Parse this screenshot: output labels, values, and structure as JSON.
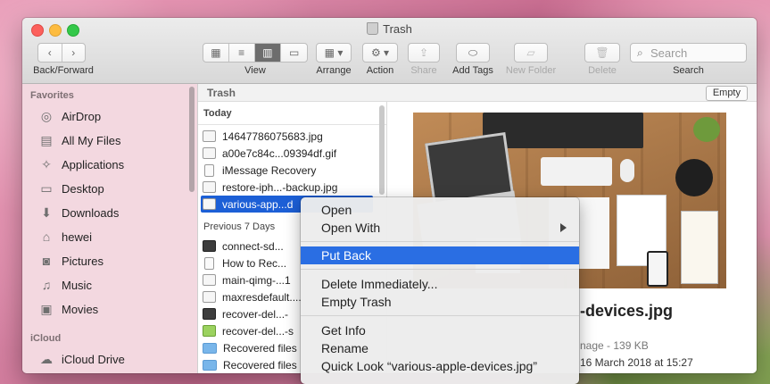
{
  "window": {
    "title": "Trash"
  },
  "toolbar": {
    "back_forward_label": "Back/Forward",
    "view_label": "View",
    "arrange_label": "Arrange",
    "action_label": "Action",
    "share_label": "Share",
    "add_tags_label": "Add Tags",
    "new_folder_label": "New Folder",
    "delete_label": "Delete",
    "search_label": "Search",
    "search_placeholder": "Search"
  },
  "sidebar": {
    "favorites_heading": "Favorites",
    "items": [
      {
        "label": "AirDrop",
        "icon": "airdrop-icon"
      },
      {
        "label": "All My Files",
        "icon": "all-files-icon"
      },
      {
        "label": "Applications",
        "icon": "applications-icon"
      },
      {
        "label": "Desktop",
        "icon": "desktop-icon"
      },
      {
        "label": "Downloads",
        "icon": "downloads-icon"
      },
      {
        "label": "hewei",
        "icon": "home-icon"
      },
      {
        "label": "Pictures",
        "icon": "camera-icon"
      },
      {
        "label": "Music",
        "icon": "music-icon"
      },
      {
        "label": "Movies",
        "icon": "movies-icon"
      }
    ],
    "icloud_heading": "iCloud",
    "icloud_items": [
      {
        "label": "iCloud Drive",
        "icon": "cloud-icon"
      }
    ]
  },
  "path_bar": {
    "title": "Trash",
    "empty_button": "Empty"
  },
  "files": {
    "today_heading": "Today",
    "today": [
      "14647786075683.jpg",
      "a00e7c84c...09394df.gif",
      "iMessage Recovery",
      "restore-iph...-backup.jpg",
      "various-app...d"
    ],
    "previous_heading": "Previous 7 Days",
    "previous": [
      "connect-sd...",
      "How to Rec...",
      "main-qimg-...1",
      "maxresdefault....",
      "recover-del...-",
      "recover-del...-s",
      "Recovered files",
      "Recovered files"
    ]
  },
  "preview": {
    "name": "-devices.jpg",
    "kind_size": "nage - 139 KB",
    "date": "16 March 2018 at 15:27"
  },
  "context_menu": {
    "open": "Open",
    "open_with": "Open With",
    "put_back": "Put Back",
    "delete_immediately": "Delete Immediately...",
    "empty_trash": "Empty Trash",
    "get_info": "Get Info",
    "rename": "Rename",
    "quick_look": "Quick Look “various-apple-devices.jpg”"
  },
  "colors": {
    "selection": "#1c5fd6",
    "menu_highlight": "#2a6ee3"
  }
}
